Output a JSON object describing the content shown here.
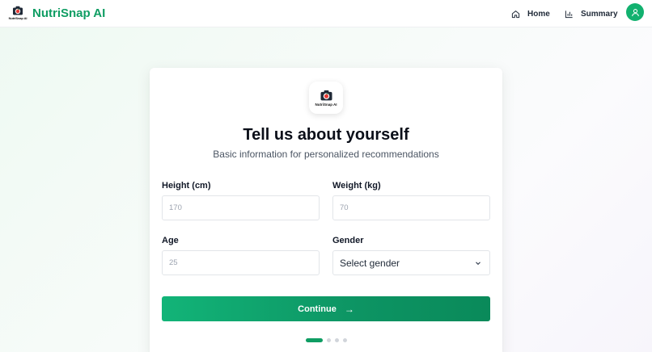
{
  "app": {
    "name": "NutriSnap AI",
    "logo_text": "NutriSnap AI"
  },
  "nav": {
    "home_label": "Home",
    "summary_label": "Summary"
  },
  "form": {
    "title": "Tell us about yourself",
    "subtitle": "Basic information for personalized recommendations",
    "height": {
      "label": "Height (cm)",
      "placeholder": "170",
      "value": ""
    },
    "weight": {
      "label": "Weight (kg)",
      "placeholder": "70",
      "value": ""
    },
    "age": {
      "label": "Age",
      "placeholder": "25",
      "value": ""
    },
    "gender": {
      "label": "Gender",
      "selected": "Select gender"
    },
    "continue_label": "Continue",
    "continue_arrow": "→",
    "progress": {
      "current_step": 1,
      "total_steps": 4
    }
  },
  "colors": {
    "brand": "#0f9d63",
    "button": "#12b478",
    "avatar": "#12b16f"
  }
}
